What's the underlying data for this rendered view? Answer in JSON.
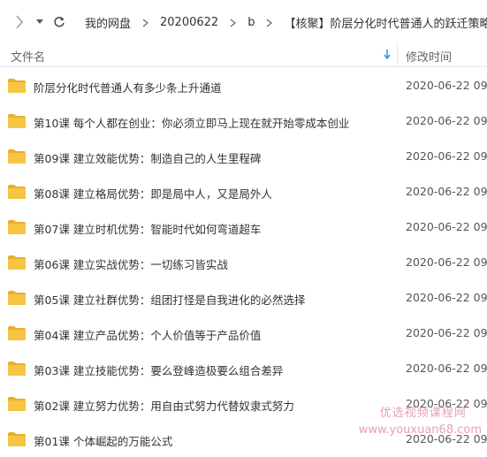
{
  "nav": {
    "icons": {
      "forward": "chevron-right-icon",
      "history": "caret-down-icon",
      "refresh": "refresh-icon"
    }
  },
  "breadcrumb": {
    "items": [
      {
        "label": "我的网盘"
      },
      {
        "label": "20200622"
      },
      {
        "label": "b"
      },
      {
        "label": "【核聚】阶层分化时代普通人的跃迁策略"
      }
    ]
  },
  "columns": {
    "name": "文件名",
    "date": "修改时间"
  },
  "colors": {
    "folder": "#F7C544",
    "folder_tab": "#E9AE2C",
    "watermark": "#E08AA0"
  },
  "files": [
    {
      "name": "阶层分化时代普通人有多少条上升通道",
      "modified": "2020-06-22 09:2"
    },
    {
      "name": "第10课 每个人都在创业：你必须立即马上现在就开始零成本创业",
      "modified": "2020-06-22 09:2"
    },
    {
      "name": "第09课 建立效能优势：制造自己的人生里程碑",
      "modified": "2020-06-22 09:2"
    },
    {
      "name": "第08课 建立格局优势：即是局中人，又是局外人",
      "modified": "2020-06-22 09:2"
    },
    {
      "name": "第07课 建立时机优势：智能时代如何弯道超车",
      "modified": "2020-06-22 09:2"
    },
    {
      "name": "第06课 建立实战优势：一切练习皆实战",
      "modified": "2020-06-22 09:2"
    },
    {
      "name": "第05课 建立社群优势：组团打怪是自我进化的必然选择",
      "modified": "2020-06-22 09:2"
    },
    {
      "name": "第04课 建立产品优势：个人价值等于产品价值",
      "modified": "2020-06-22 09:2"
    },
    {
      "name": "第03课 建立技能优势：要么登峰造极要么组合差异",
      "modified": "2020-06-22 09:2"
    },
    {
      "name": "第02课 建立努力优势：用自由式努力代替奴隶式努力",
      "modified": "2020-06-22 09:2"
    },
    {
      "name": "第01课 个体崛起的万能公式",
      "modified": "2020-06-22 09:2"
    }
  ],
  "watermark": {
    "line1": "优选视频课程网",
    "line2": "www.youxuan68.com"
  }
}
